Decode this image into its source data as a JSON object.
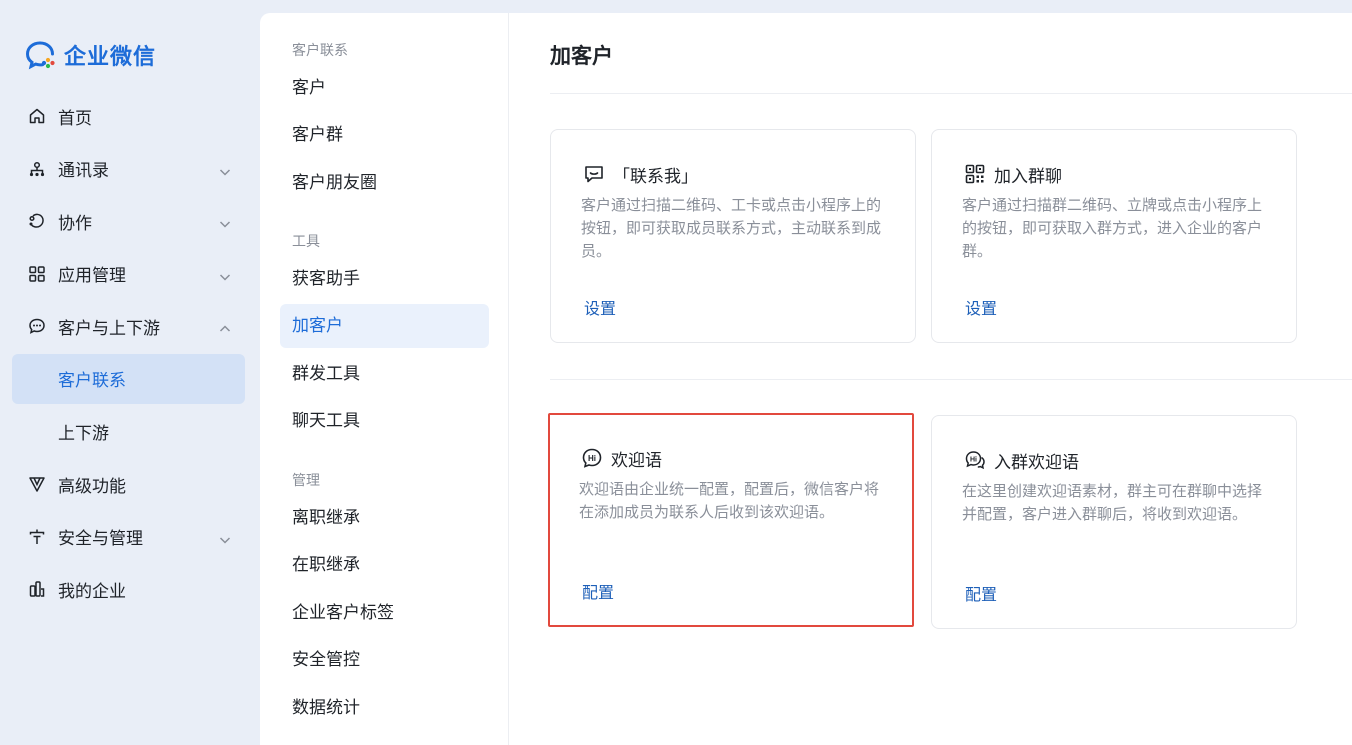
{
  "brand": {
    "name": "企业微信",
    "accent": "#1d6cd8",
    "highlight": "#e2493d"
  },
  "nav": {
    "items": [
      {
        "label": "首页",
        "icon": "home-icon"
      },
      {
        "label": "通讯录",
        "icon": "org-chart-icon",
        "chevron": "down"
      },
      {
        "label": "协作",
        "icon": "collaboration-icon",
        "chevron": "down"
      },
      {
        "label": "应用管理",
        "icon": "apps-grid-icon",
        "chevron": "down"
      },
      {
        "label": "客户与上下游",
        "icon": "chat-bubble-icon",
        "chevron": "up"
      },
      {
        "label": "客户联系",
        "active": true
      },
      {
        "label": "上下游"
      },
      {
        "label": "高级功能",
        "icon": "triangle-logo-icon"
      },
      {
        "label": "安全与管理",
        "icon": "shield-icon",
        "chevron": "down"
      },
      {
        "label": "我的企业",
        "icon": "building-icon"
      }
    ]
  },
  "submenu": {
    "groups": [
      {
        "title": "客户联系",
        "items": [
          "客户",
          "客户群",
          "客户朋友圈"
        ]
      },
      {
        "title": "工具",
        "items": [
          "获客助手",
          "加客户",
          "群发工具",
          "聊天工具"
        ]
      },
      {
        "title": "管理",
        "items": [
          "离职继承",
          "在职继承",
          "企业客户标签",
          "安全管控",
          "数据统计"
        ]
      }
    ],
    "active": "加客户"
  },
  "main": {
    "title": "加客户",
    "cards": [
      {
        "title": "「联系我」",
        "icon": "message-square-icon",
        "desc": "客户通过扫描二维码、工卡或点击小程序上的按钮，即可获取成员联系方式，主动联系到成员。",
        "link": "设置"
      },
      {
        "title": "加入群聊",
        "icon": "qr-code-icon",
        "desc": "客户通过扫描群二维码、立牌或点击小程序上的按钮，即可获取入群方式，进入企业的客户群。",
        "link": "设置"
      },
      {
        "title": "欢迎语",
        "icon": "hi-bubble-icon",
        "desc": "欢迎语由企业统一配置，配置后，微信客户将在添加成员为联系人后收到该欢迎语。",
        "link": "配置",
        "highlighted": true
      },
      {
        "title": "入群欢迎语",
        "icon": "group-hi-bubble-icon",
        "desc": "在这里创建欢迎语素材，群主可在群聊中选择并配置，客户进入群聊后，将收到欢迎语。",
        "link": "配置"
      }
    ]
  }
}
